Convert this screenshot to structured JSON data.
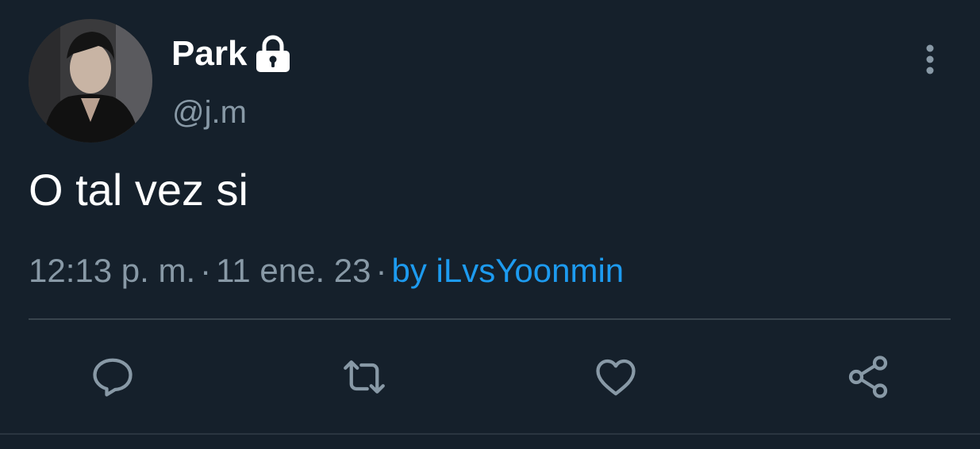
{
  "tweet": {
    "author_name": "Park",
    "handle": "@j.m",
    "text": "O tal vez si",
    "time": "12:13 p. m.",
    "date": "11 ene. 23",
    "separator": "·",
    "source": "by iLvsYoonmin"
  },
  "icons": {
    "lock": "lock-icon",
    "more": "more-vertical-icon",
    "reply": "reply-icon",
    "retweet": "retweet-icon",
    "like": "heart-icon",
    "share": "share-icon"
  },
  "colors": {
    "background": "#15202b",
    "primary_text": "#ffffff",
    "secondary_text": "#8899a6",
    "link": "#1d9bf0",
    "divider": "#38444d"
  }
}
